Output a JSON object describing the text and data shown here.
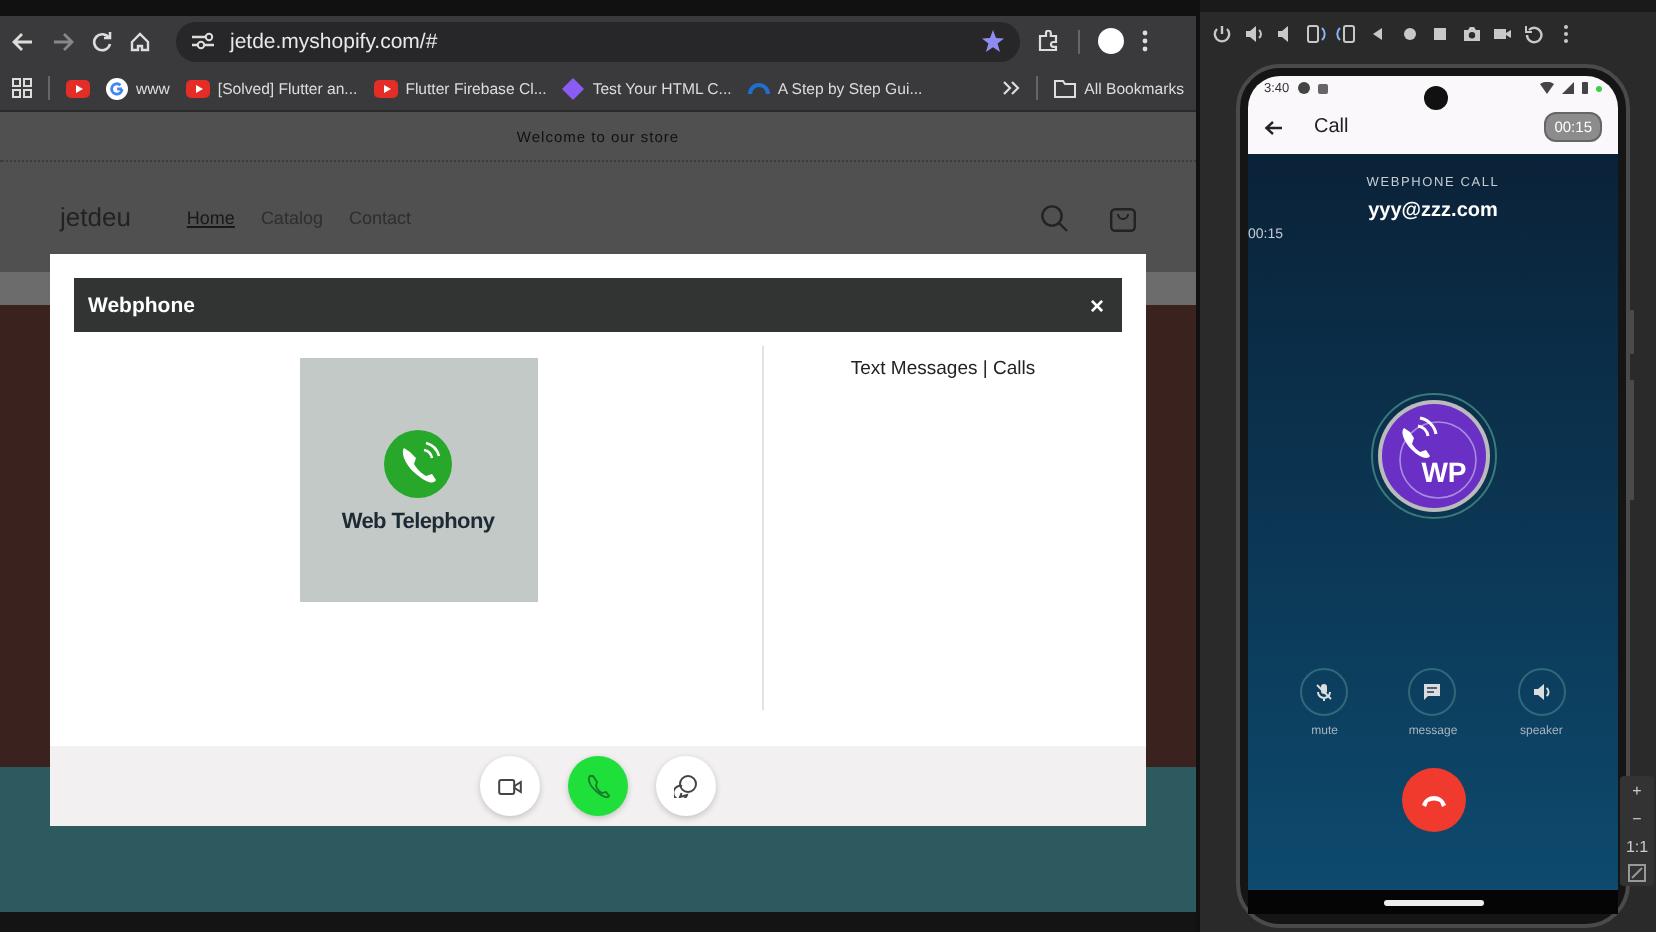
{
  "browser": {
    "url": "jetde.myshopify.com/#",
    "bookmarks": [
      {
        "kind": "youtube"
      },
      {
        "kind": "google",
        "label": "www"
      },
      {
        "kind": "youtube",
        "label": "[Solved] Flutter an..."
      },
      {
        "kind": "youtube",
        "label": "Flutter Firebase Cl..."
      },
      {
        "kind": "diamond",
        "label": "Test Your HTML C..."
      },
      {
        "kind": "wave",
        "label": "A Step by Step Gui..."
      }
    ],
    "all_bookmarks": "All Bookmarks"
  },
  "store": {
    "announcement": "Welcome to our store",
    "logo": "jetdeu",
    "nav": [
      {
        "label": "Home",
        "selected": true
      },
      {
        "label": "Catalog",
        "selected": false
      },
      {
        "label": "Contact",
        "selected": false
      }
    ]
  },
  "modal": {
    "title": "Webphone",
    "close": "×",
    "logo_text": "Web Telephony",
    "side_heading": "Text Messages | Calls",
    "actions": [
      {
        "kind": "video"
      },
      {
        "kind": "call"
      },
      {
        "kind": "chat"
      }
    ]
  },
  "phone": {
    "time": "3:40",
    "app_title": "Call",
    "timer_badge": "00:15",
    "call_label": "WEBPHONE CALL",
    "contact": "yyy@zzz.com",
    "elapsed": "00:15",
    "avatar_text": "WP",
    "controls": [
      {
        "kind": "mute",
        "label": "mute"
      },
      {
        "kind": "message",
        "label": "message"
      },
      {
        "kind": "speaker",
        "label": "speaker"
      }
    ]
  },
  "emulator": {
    "zoom_controls": [
      {
        "label": "+"
      },
      {
        "label": "−"
      },
      {
        "label": "1:1"
      }
    ]
  }
}
